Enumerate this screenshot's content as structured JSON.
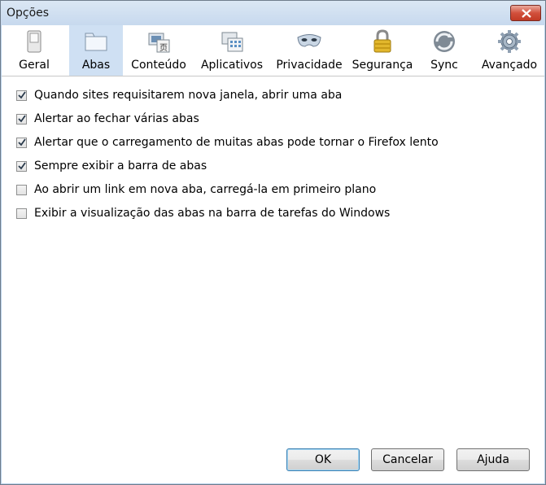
{
  "window": {
    "title": "Opções"
  },
  "tabs": [
    {
      "label": "Geral",
      "icon": "switch-icon"
    },
    {
      "label": "Abas",
      "icon": "tabs-icon",
      "selected": true
    },
    {
      "label": "Conteúdo",
      "icon": "content-icon"
    },
    {
      "label": "Aplicativos",
      "icon": "applications-icon"
    },
    {
      "label": "Privacidade",
      "icon": "mask-icon"
    },
    {
      "label": "Segurança",
      "icon": "lock-icon"
    },
    {
      "label": "Sync",
      "icon": "sync-icon"
    },
    {
      "label": "Avançado",
      "icon": "gear-icon"
    }
  ],
  "options": [
    {
      "label": "Quando sites requisitarem nova janela, abrir uma aba",
      "checked": true
    },
    {
      "label": "Alertar ao fechar várias abas",
      "checked": true
    },
    {
      "label": "Alertar que o carregamento de muitas abas pode tornar o Firefox lento",
      "checked": true
    },
    {
      "label": "Sempre exibir a barra de abas",
      "checked": true
    },
    {
      "label": "Ao abrir um link em nova aba, carregá-la em primeiro plano",
      "checked": false
    },
    {
      "label": "Exibir a visualização das abas na barra de tarefas do Windows",
      "checked": false
    }
  ],
  "buttons": {
    "ok": "OK",
    "cancel": "Cancelar",
    "help": "Ajuda"
  }
}
